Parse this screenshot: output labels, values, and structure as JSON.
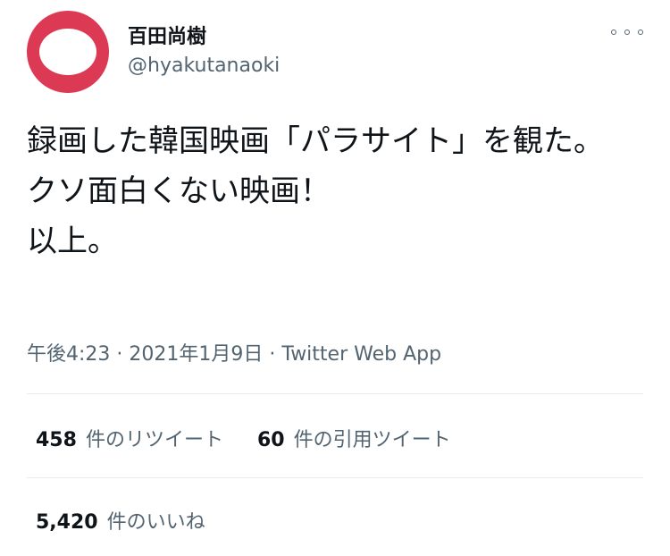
{
  "author": {
    "display_name": "百田尚樹",
    "handle": "@hyakutanaoki",
    "avatar_color": "#dc3a54"
  },
  "tweet": {
    "text": "録画した韓国映画「パラサイト」を観た。\nクソ面白くない映画！\n以上。"
  },
  "meta": {
    "time": "午後4:23",
    "separator": "·",
    "date": "2021年1月9日",
    "source": "Twitter Web App"
  },
  "stats": {
    "retweets": {
      "count": "458",
      "label": "件のリツイート"
    },
    "quotes": {
      "count": "60",
      "label": "件の引用ツイート"
    },
    "likes": {
      "count": "5,420",
      "label": "件のいいね"
    }
  },
  "colors": {
    "text_primary": "#0f1419",
    "text_secondary": "#536471",
    "divider": "#e6ecf0"
  },
  "icons": {
    "more": "more-icon"
  }
}
